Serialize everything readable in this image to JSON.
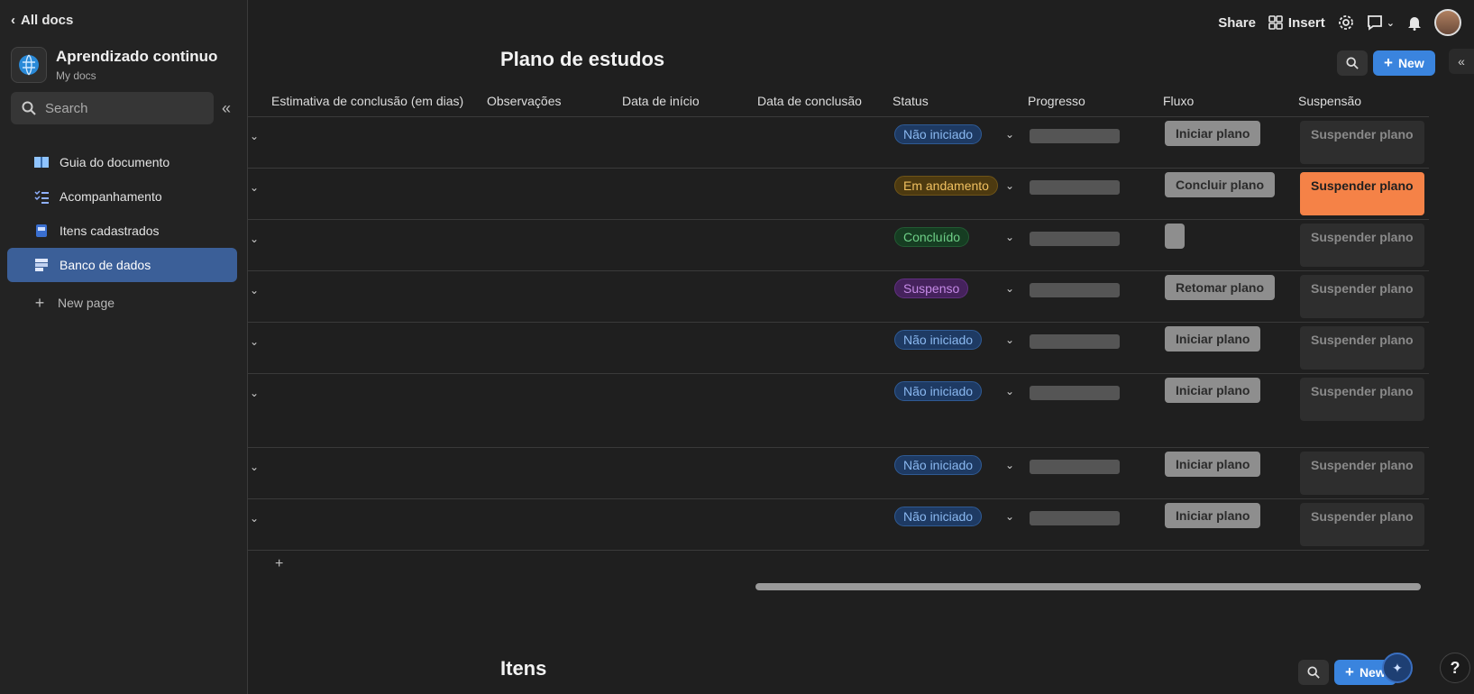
{
  "sidebar": {
    "back_label": "All docs",
    "doc_title": "Aprendizado continuo",
    "doc_subtitle": "My docs",
    "search_placeholder": "Search",
    "items": [
      {
        "label": "Guia do documento",
        "icon": "book-icon"
      },
      {
        "label": "Acompanhamento",
        "icon": "checklist-icon"
      },
      {
        "label": "Itens cadastrados",
        "icon": "card-icon"
      },
      {
        "label": "Banco de dados",
        "icon": "database-icon",
        "active": true
      }
    ],
    "new_page_label": "New page"
  },
  "topbar": {
    "share_label": "Share",
    "insert_label": "Insert"
  },
  "main": {
    "title": "Plano de estudos",
    "new_label": "New",
    "second_title": "Itens",
    "second_new_label": "New",
    "help_label": "?"
  },
  "table": {
    "columns": [
      "Estimativa de conclusão (em dias)",
      "Observações",
      "Data de início",
      "Data de conclusão",
      "Status",
      "Progresso",
      "Fluxo",
      "Suspensão"
    ],
    "rows": [
      {
        "status": "Não iniciado",
        "status_kind": "ni",
        "flow": "Iniciar plano",
        "suspension": "Suspender plano",
        "suspension_active": false
      },
      {
        "status": "Em andamento",
        "status_kind": "ea",
        "flow": "Concluir plano",
        "suspension": "Suspender plano",
        "suspension_active": true
      },
      {
        "status": "Concluído",
        "status_kind": "co",
        "flow": "",
        "suspension": "Suspender plano",
        "suspension_active": false
      },
      {
        "status": "Suspenso",
        "status_kind": "su",
        "flow": "Retomar plano",
        "suspension": "Suspender plano",
        "suspension_active": false
      },
      {
        "status": "Não iniciado",
        "status_kind": "ni",
        "flow": "Iniciar plano",
        "suspension": "Suspender plano",
        "suspension_active": false
      },
      {
        "status": "Não iniciado",
        "status_kind": "ni",
        "flow": "Iniciar plano",
        "suspension": "Suspender plano",
        "suspension_active": false
      },
      {
        "status": "Não iniciado",
        "status_kind": "ni",
        "flow": "Iniciar plano",
        "suspension": "Suspender plano",
        "suspension_active": false
      },
      {
        "status": "Não iniciado",
        "status_kind": "ni",
        "flow": "Iniciar plano",
        "suspension": "Suspender plano",
        "suspension_active": false
      }
    ],
    "add_row_label": "+"
  },
  "colors": {
    "accent": "#3a84de",
    "active_nav": "#3b5f98",
    "suspend_active": "#f58247"
  }
}
